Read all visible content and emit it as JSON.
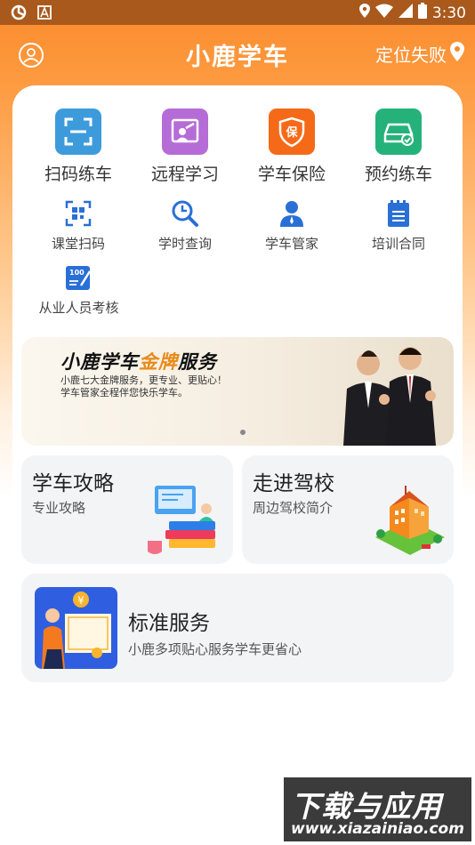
{
  "status_bar": {
    "time": "3:30"
  },
  "header": {
    "title": "小鹿学车",
    "location_label": "定位失败"
  },
  "features": [
    {
      "label": "扫码练车",
      "color": "#3d9bdc"
    },
    {
      "label": "远程学习",
      "color": "#b66cd6"
    },
    {
      "label": "学车保险",
      "color": "#f56a18"
    },
    {
      "label": "预约练车",
      "color": "#25b27a"
    }
  ],
  "sub_features": [
    {
      "label": "课堂扫码"
    },
    {
      "label": "学时查询"
    },
    {
      "label": "学车管家"
    },
    {
      "label": "培训合同"
    },
    {
      "label": "从业人员考核"
    }
  ],
  "banner": {
    "title_black": "小鹿学车",
    "title_gold": "金牌",
    "title_black2": "服务",
    "line1": "小鹿七大金牌服务，更专业、更贴心！",
    "line2": "学车管家全程伴您快乐学车。"
  },
  "cards": {
    "guide": {
      "title": "学车攻略",
      "subtitle": "专业攻略"
    },
    "school": {
      "title": "走进驾校",
      "subtitle": "周边驾校简介"
    },
    "service": {
      "title": "标准服务",
      "subtitle": "小鹿多项贴心服务学车更省心"
    }
  },
  "watermark": {
    "line1": "下载与应用",
    "line2": "www.xiazainiao.com"
  },
  "colors": {
    "brand_orange": "#fb8a2c",
    "sub_icon_blue": "#2a6fd6"
  }
}
